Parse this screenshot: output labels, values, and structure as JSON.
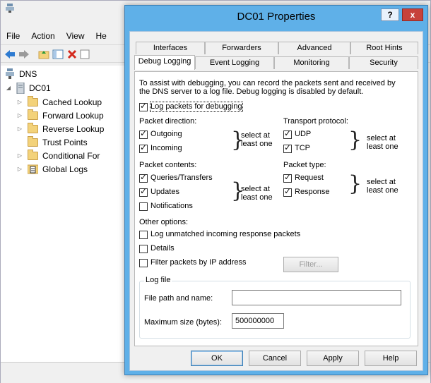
{
  "background": {
    "menu": [
      "File",
      "Action",
      "View",
      "He"
    ],
    "tree": {
      "root": "DNS",
      "server": "DC01",
      "items": [
        "Cached Lookup",
        "Forward Lookup",
        "Reverse Lookup",
        "Trust Points",
        "Conditional For",
        "Global Logs"
      ]
    }
  },
  "dialog": {
    "title": "DC01 Properties",
    "help_label": "?",
    "close_label": "x",
    "tabs_row1": [
      "Interfaces",
      "Forwarders",
      "Advanced",
      "Root Hints"
    ],
    "tabs_row2": [
      "Debug Logging",
      "Event Logging",
      "Monitoring",
      "Security"
    ],
    "description_line1": "To assist with debugging, you can record the packets sent and received by",
    "description_line2": "the DNS server to a log file. Debug logging is disabled by default.",
    "log_packets_label": "Log packets for debugging",
    "packet_direction": {
      "heading": "Packet direction:",
      "outgoing": "Outgoing",
      "incoming": "Incoming",
      "note1": "select at",
      "note2": "least one"
    },
    "transport_protocol": {
      "heading": "Transport protocol:",
      "udp": "UDP",
      "tcp": "TCP",
      "note1": "select at",
      "note2": "least one"
    },
    "packet_contents": {
      "heading": "Packet contents:",
      "queries": "Queries/Transfers",
      "updates": "Updates",
      "notifications": "Notifications",
      "note1": "select at",
      "note2": "least one"
    },
    "packet_type": {
      "heading": "Packet type:",
      "request": "Request",
      "response": "Response",
      "note1": "select at",
      "note2": "least one"
    },
    "other_options": {
      "heading": "Other options:",
      "log_unmatched": "Log unmatched incoming response packets",
      "details": "Details",
      "filter_by_ip": "Filter packets by IP address",
      "filter_button": "Filter..."
    },
    "log_file": {
      "heading": "Log file",
      "path_label": "File path and name:",
      "path_value": "",
      "max_size_label": "Maximum size (bytes):",
      "max_size_value": "500000000"
    },
    "buttons": {
      "ok": "OK",
      "cancel": "Cancel",
      "apply": "Apply",
      "help": "Help"
    }
  }
}
